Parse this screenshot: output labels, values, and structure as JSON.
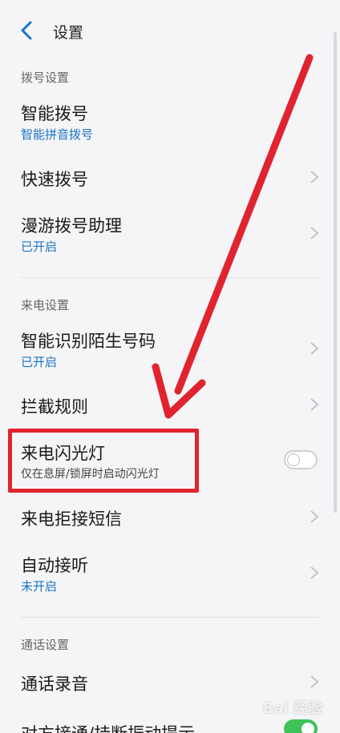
{
  "header": {
    "title": "设置"
  },
  "sections": {
    "dial": "拨号设置",
    "incoming": "来电设置",
    "call": "通话设置"
  },
  "items": {
    "smart_dial": {
      "label": "智能拨号",
      "sub": "智能拼音拨号"
    },
    "speed_dial": {
      "label": "快速拨号"
    },
    "roaming": {
      "label": "漫游拨号助理",
      "sub": "已开启"
    },
    "identify": {
      "label": "智能识别陌生号码",
      "sub": "已开启"
    },
    "block": {
      "label": "拦截规则"
    },
    "flash": {
      "label": "来电闪光灯",
      "sub": "仅在息屏/锁屏时启动闪光灯",
      "toggle": "off"
    },
    "reject_sms": {
      "label": "来电拒接短信"
    },
    "auto_answer": {
      "label": "自动接听",
      "sub": "未开启"
    },
    "record": {
      "label": "通话录音"
    },
    "vibrate": {
      "label": "对方接通/挂断振动提示",
      "toggle": "on"
    }
  },
  "colors": {
    "accent_blue": "#1a73c7",
    "highlight_red": "#e0242f",
    "toggle_on": "#3ec35a"
  },
  "watermark": "Bai 经验"
}
